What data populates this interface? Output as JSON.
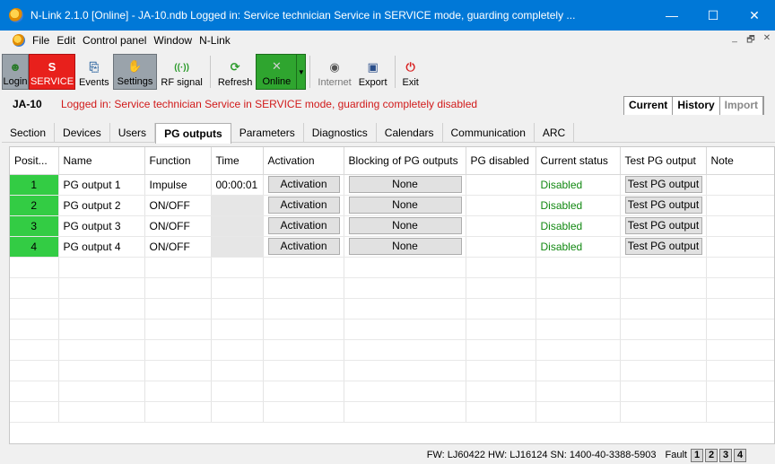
{
  "window": {
    "title": "N-Link 2.1.0 [Online] - JA-10.ndb Logged in: Service technician Service in SERVICE mode, guarding completely ...",
    "controls": {
      "minimize": "—",
      "maximize": "☐",
      "close": "✕"
    }
  },
  "menu": {
    "items": [
      "File",
      "Edit",
      "Control panel",
      "Window",
      "N-Link"
    ],
    "mdi_controls": {
      "minimize": "_",
      "restore": "🗗",
      "close": "✕"
    }
  },
  "toolbar": {
    "login": "Login",
    "service": "SERVICE",
    "events": "Events",
    "settings": "Settings",
    "rf_signal": "RF signal",
    "refresh": "Refresh",
    "online": "Online",
    "internet": "Internet",
    "export": "Export",
    "exit": "Exit"
  },
  "info": {
    "device": "JA-10",
    "message": "Logged in: Service technician Service in SERVICE mode, guarding completely disabled",
    "view_tabs": [
      "Current",
      "History",
      "Import"
    ]
  },
  "tabs": [
    "Section",
    "Devices",
    "Users",
    "PG outputs",
    "Parameters",
    "Diagnostics",
    "Calendars",
    "Communication",
    "ARC"
  ],
  "active_tab": "PG outputs",
  "grid": {
    "columns": [
      "Posit...",
      "Name",
      "Function",
      "Time",
      "Activation",
      "Blocking of PG outputs",
      "PG disabled",
      "Current status",
      "Test PG output",
      "Note"
    ],
    "rows": [
      {
        "pos": "1",
        "name": "PG output 1",
        "function": "Impulse",
        "time": "00:00:01",
        "activation": "Activation",
        "blocking": "None",
        "disabled": "",
        "status": "Disabled",
        "test": "Test PG output",
        "note": ""
      },
      {
        "pos": "2",
        "name": "PG output 2",
        "function": "ON/OFF",
        "time": "",
        "activation": "Activation",
        "blocking": "None",
        "disabled": "",
        "status": "Disabled",
        "test": "Test PG output",
        "note": ""
      },
      {
        "pos": "3",
        "name": "PG output 3",
        "function": "ON/OFF",
        "time": "",
        "activation": "Activation",
        "blocking": "None",
        "disabled": "",
        "status": "Disabled",
        "test": "Test PG output",
        "note": ""
      },
      {
        "pos": "4",
        "name": "PG output 4",
        "function": "ON/OFF",
        "time": "",
        "activation": "Activation",
        "blocking": "None",
        "disabled": "",
        "status": "Disabled",
        "test": "Test PG output",
        "note": ""
      }
    ]
  },
  "statusbar": {
    "firmware": "FW: LJ60422 HW: LJ16124 SN: 1400-40-3388-5903",
    "fault": "Fault",
    "sections": [
      "1",
      "2",
      "3",
      "4"
    ]
  },
  "colors": {
    "titlebar": "#0078d7",
    "service": "#e8201c",
    "online": "#2fa52f",
    "position_cell": "#33cc44",
    "status_text": "#118811",
    "warning_text": "#d11a1a"
  }
}
